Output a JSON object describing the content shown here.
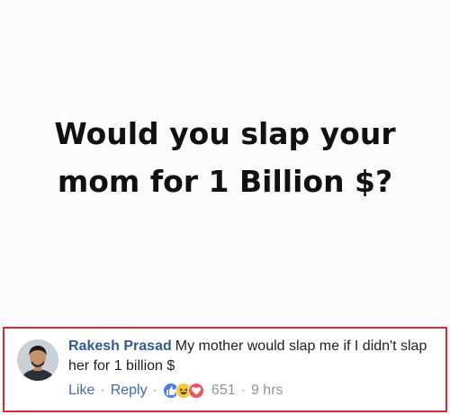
{
  "headline": {
    "line1": "Would you slap your",
    "line2": "mom for 1 Billion $?"
  },
  "comment": {
    "author": "Rakesh Prasad",
    "text": "My mother would slap me if I didn't slap her for 1 billion $",
    "actions": {
      "like_label": "Like",
      "reply_label": "Reply",
      "separator": "·",
      "reaction_count": "651",
      "time": "9 hrs"
    },
    "reactions": [
      "like-icon",
      "haha-icon",
      "love-icon"
    ]
  },
  "colors": {
    "highlight_border": "#d62b2b",
    "author_link": "#365899",
    "action_link": "#4267b2",
    "meta_text": "#90949c",
    "like": "#4a7cf0",
    "haha": "#f7c93b",
    "love": "#f0525a"
  }
}
